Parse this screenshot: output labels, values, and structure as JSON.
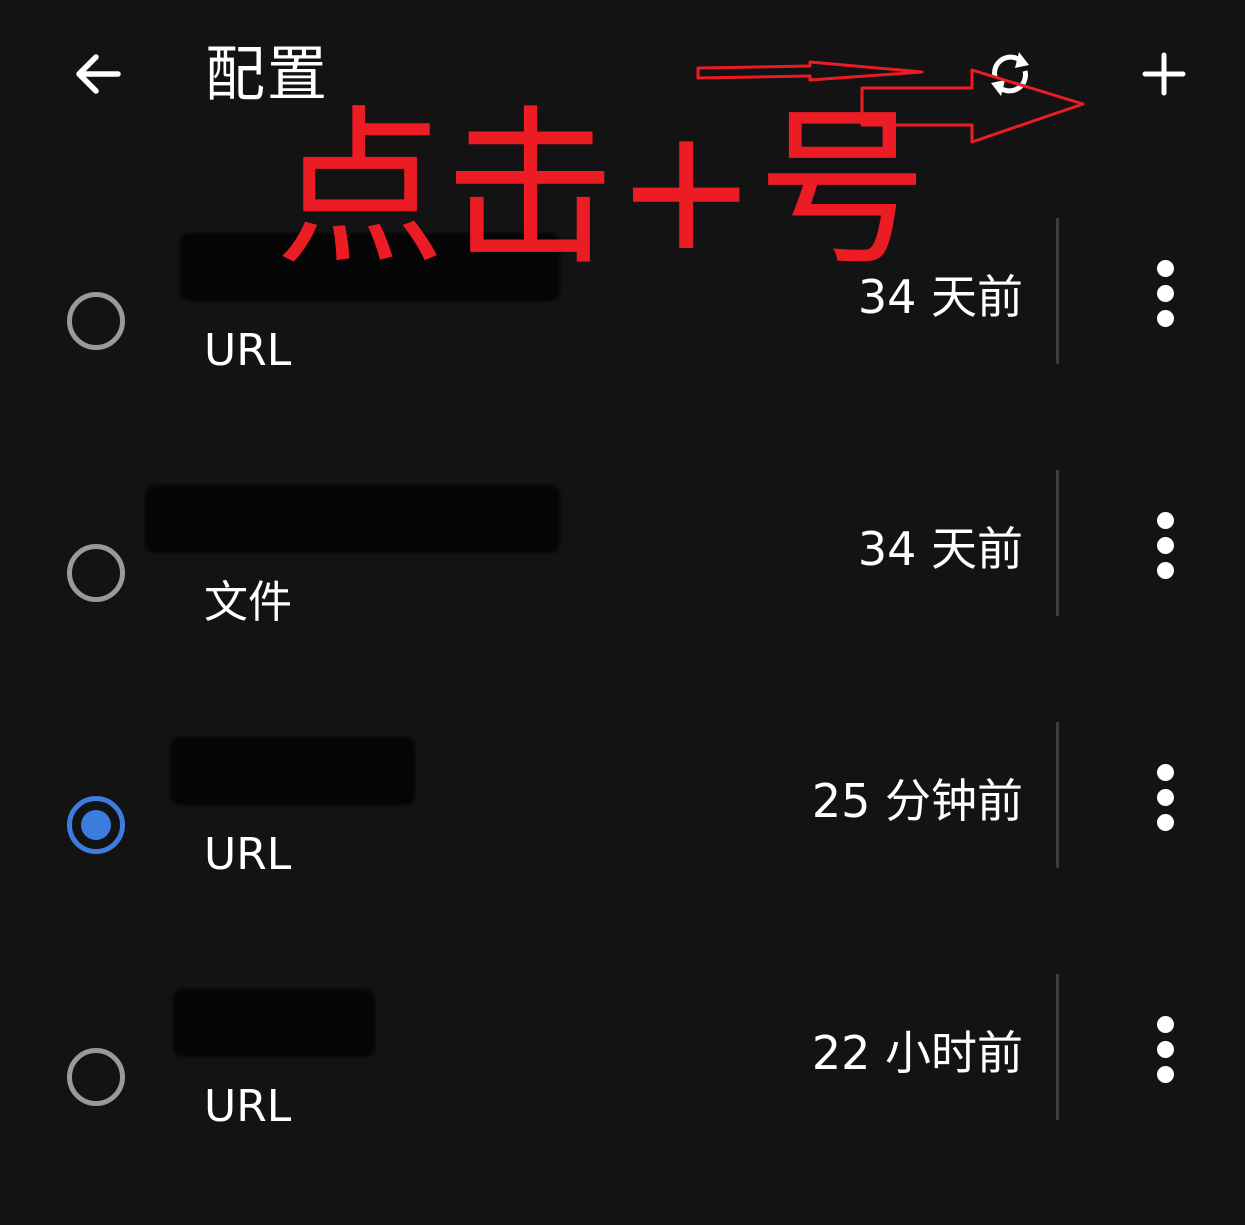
{
  "header": {
    "title": "配置",
    "back_icon": "arrow-left-icon",
    "refresh_icon": "refresh-icon",
    "add_icon": "plus-icon"
  },
  "profiles": [
    {
      "type": "URL",
      "updated": "34 天前",
      "selected": false
    },
    {
      "type": "文件",
      "updated": "34 天前",
      "selected": false
    },
    {
      "type": "URL",
      "updated": "25 分钟前",
      "selected": true
    },
    {
      "type": "URL",
      "updated": "22 小时前",
      "selected": false
    }
  ],
  "annotation": {
    "text": "点击+号",
    "color": "#ec1c24"
  },
  "colors": {
    "background": "#131313",
    "accent": "#3d7de0",
    "radio_border": "#9a9a9a",
    "divider": "#3d3d3d"
  }
}
